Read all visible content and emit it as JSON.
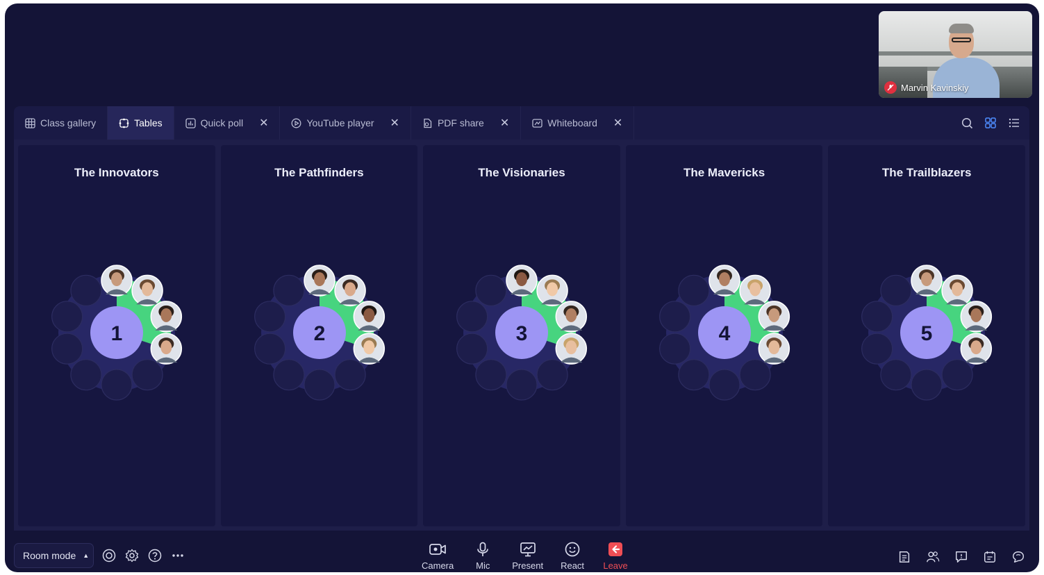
{
  "presenter": {
    "name": "Marvin Kavinskiy"
  },
  "tabs": [
    {
      "label": "Class gallery",
      "icon": "grid-icon",
      "closable": false,
      "active": false
    },
    {
      "label": "Tables",
      "icon": "tables-icon",
      "closable": false,
      "active": true
    },
    {
      "label": "Quick poll",
      "icon": "poll-icon",
      "closable": true,
      "active": false
    },
    {
      "label": "YouTube player",
      "icon": "play-icon",
      "closable": true,
      "active": false
    },
    {
      "label": "PDF share",
      "icon": "pdf-icon",
      "closable": true,
      "active": false
    },
    {
      "label": "Whiteboard",
      "icon": "whiteboard-icon",
      "closable": true,
      "active": false
    }
  ],
  "toolbar_right": [
    "search-icon",
    "grid-view-icon",
    "list-view-icon"
  ],
  "tables": [
    {
      "number": "1",
      "name": "The Innovators",
      "occupied_seats": 4,
      "total_seats": 10
    },
    {
      "number": "2",
      "name": "The Pathfinders",
      "occupied_seats": 4,
      "total_seats": 10
    },
    {
      "number": "3",
      "name": "The Visionaries",
      "occupied_seats": 4,
      "total_seats": 10
    },
    {
      "number": "4",
      "name": "The Mavericks",
      "occupied_seats": 4,
      "total_seats": 10
    },
    {
      "number": "5",
      "name": "The Trailblazers",
      "occupied_seats": 4,
      "total_seats": 10
    }
  ],
  "bottom": {
    "room_mode": "Room mode",
    "left_icons": [
      "record-icon",
      "settings-icon",
      "help-icon",
      "more-icon"
    ],
    "controls": [
      {
        "label": "Camera",
        "icon": "camera-icon"
      },
      {
        "label": "Mic",
        "icon": "mic-icon"
      },
      {
        "label": "Present",
        "icon": "present-icon"
      },
      {
        "label": "React",
        "icon": "react-icon"
      },
      {
        "label": "Leave",
        "icon": "leave-icon"
      }
    ],
    "right_icons": [
      "notes-icon",
      "participants-icon",
      "chat-icon",
      "calendar-icon",
      "whisper-icon"
    ]
  },
  "colors": {
    "background": "#141437",
    "panel": "#161640",
    "accent_purple": "#9d95f4",
    "seat_green": "#47d47f",
    "leave_red": "#f04e55"
  }
}
